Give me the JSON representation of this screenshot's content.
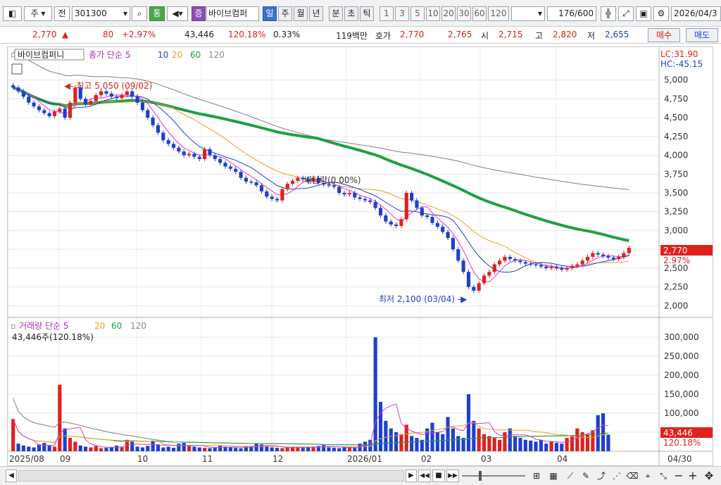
{
  "toolbar": {
    "market": "주",
    "period_type": "전",
    "code": "301300",
    "tab_type": "통",
    "badge_type": "증",
    "stock_name": "바이브컴퍼",
    "periods": [
      "일",
      "주",
      "월",
      "년",
      "분",
      "초",
      "틱"
    ],
    "numbers": [
      "1",
      "3",
      "5",
      "10",
      "20",
      "30",
      "60",
      "120"
    ],
    "count": "176",
    "count_total": "/600",
    "date": "2026/04/3"
  },
  "quote": {
    "price": "2,770",
    "up_mark": "▲",
    "change": "80",
    "change_pct": "+2.97%",
    "volume": "43,446",
    "volume_ratio": "120.18%",
    "turnover": "0.33%",
    "amount": "119백만",
    "bid_label": "호가",
    "bid1": "2,770",
    "bid2": "2,765",
    "open_label": "시",
    "open": "2,715",
    "high_label": "고",
    "high": "2,820",
    "low_label": "저",
    "low": "2,655",
    "buy_label": "매수",
    "sell_label": "매도"
  },
  "price_legend": {
    "name": "바이브컴퍼니",
    "close_label": "종가",
    "ma_label": "단순",
    "ma_periods": [
      "5",
      "10",
      "20",
      "60",
      "120"
    ],
    "lc": "LC:31.90",
    "hc": "HC:-45.15",
    "high_annot": "최고 5,050 (09/02)",
    "low_annot": "최저 2,100 (03/04)",
    "div_annot": "배당락(0.00%)",
    "last_price": "2,770",
    "last_pct": "2.97%"
  },
  "volume_legend": {
    "label": "거래량",
    "ma_label": "단순",
    "ma_periods": [
      "5",
      "20",
      "60",
      "120"
    ],
    "current": "43,446주(120.18%)",
    "last_vol": "43,446",
    "last_pct": "120.18%"
  },
  "x_labels": [
    "2025/08",
    "09",
    "10",
    "11",
    "12",
    "2026/01",
    "02",
    "03",
    "04",
    "04/30"
  ],
  "colors": {
    "up": "#e0201b",
    "down": "#1d3fd0",
    "ma5": "#d63ad6",
    "ma10": "#1d3fd0",
    "ma20": "#e6a21a",
    "ma60": "#1ea043",
    "ma120": "#808080"
  },
  "chart_data": {
    "type": "candlestick",
    "price_axis": {
      "ticks": [
        "5,000",
        "4,750",
        "4,500",
        "4,250",
        "4,000",
        "3,750",
        "3,500",
        "3,250",
        "3,000",
        "2,750",
        "2,500",
        "2,250",
        "2,000"
      ],
      "range": [
        1900,
        5250
      ]
    },
    "volume_axis": {
      "ticks": [
        "300,000",
        "250,000",
        "200,000",
        "150,000",
        "100,000",
        "50,000"
      ],
      "range": [
        0,
        330000
      ]
    },
    "closes": [
      4900,
      4850,
      4780,
      4700,
      4650,
      4600,
      4560,
      4520,
      4580,
      4620,
      4500,
      4700,
      4900,
      4750,
      4680,
      4720,
      4800,
      4850,
      4820,
      4780,
      4760,
      4800,
      4850,
      4780,
      4700,
      4600,
      4500,
      4400,
      4300,
      4200,
      4150,
      4100,
      4050,
      4000,
      4020,
      3980,
      3950,
      4080,
      4000,
      3950,
      3900,
      3850,
      3820,
      3780,
      3700,
      3650,
      3640,
      3600,
      3520,
      3450,
      3420,
      3400,
      3550,
      3620,
      3660,
      3700,
      3680,
      3650,
      3700,
      3630,
      3610,
      3600,
      3580,
      3500,
      3480,
      3500,
      3440,
      3420,
      3400,
      3380,
      3300,
      3200,
      3120,
      3080,
      3060,
      3150,
      3500,
      3400,
      3300,
      3200,
      3180,
      3100,
      3050,
      2980,
      2900,
      2750,
      2600,
      2450,
      2250,
      2200,
      2300,
      2400,
      2450,
      2550,
      2600,
      2650,
      2620,
      2600,
      2580,
      2560,
      2550,
      2540,
      2520,
      2500,
      2520,
      2500,
      2480,
      2500,
      2530,
      2550,
      2600,
      2650,
      2700,
      2680,
      2660,
      2640,
      2620,
      2650,
      2700,
      2770
    ],
    "volumes": [
      85000,
      20000,
      15000,
      12000,
      10000,
      18000,
      22000,
      15000,
      12000,
      175000,
      60000,
      35000,
      25000,
      15000,
      12000,
      10000,
      14000,
      8000,
      9000,
      10000,
      15000,
      12000,
      30000,
      25000,
      12000,
      10000,
      14000,
      28000,
      18000,
      10000,
      12000,
      9000,
      20000,
      22000,
      14000,
      12000,
      10000,
      9000,
      8000,
      10000,
      15000,
      12000,
      10000,
      9000,
      8000,
      12000,
      14000,
      20000,
      18000,
      12000,
      10000,
      9000,
      8000,
      10000,
      12000,
      11000,
      9000,
      10000,
      12000,
      14000,
      16000,
      10000,
      9000,
      8000,
      10000,
      12000,
      9000,
      20000,
      25000,
      30000,
      300000,
      130000,
      80000,
      60000,
      50000,
      45000,
      70000,
      40000,
      35000,
      30000,
      60000,
      75000,
      50000,
      45000,
      90000,
      60000,
      40000,
      35000,
      150000,
      80000,
      60000,
      45000,
      40000,
      35000,
      30000,
      50000,
      60000,
      40000,
      35000,
      30000,
      28000,
      25000,
      30000,
      20000,
      25000,
      22000,
      20000,
      35000,
      40000,
      60000,
      50000,
      45000,
      55000,
      95000,
      100000,
      43446
    ]
  }
}
